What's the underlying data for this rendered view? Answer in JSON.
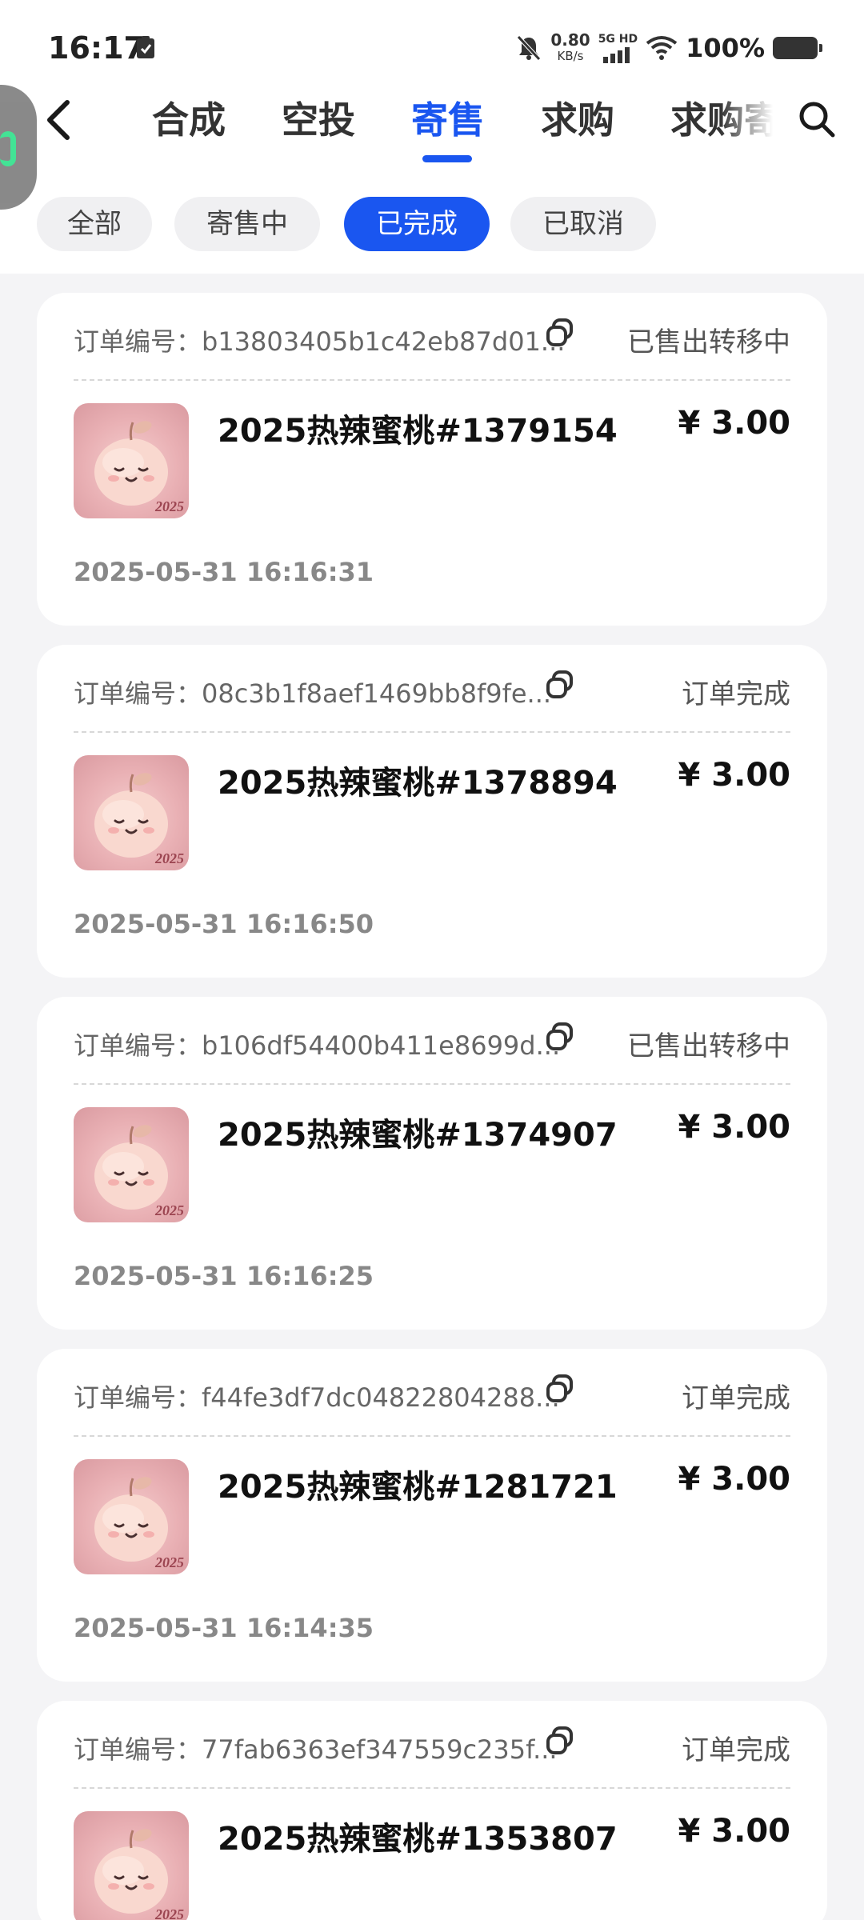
{
  "status_bar": {
    "time": "16:17",
    "net_speed_value": "0.80",
    "net_speed_unit": "KB/s",
    "network_type": "5G HD",
    "battery_percent": "100%"
  },
  "nav": {
    "tabs": [
      "合成",
      "空投",
      "寄售",
      "求购",
      "求购寄"
    ],
    "active_tab": "寄售"
  },
  "filters": {
    "chips": [
      "全部",
      "寄售中",
      "已完成",
      "已取消"
    ],
    "active_chip": "已完成"
  },
  "orders": [
    {
      "order_label": "订单编号：b13803405b1c42eb87d01...",
      "status": "已售出转移中",
      "name": "2025热辣蜜桃#1379154",
      "price": "¥ 3.00",
      "time": "2025-05-31 16:16:31"
    },
    {
      "order_label": "订单编号：08c3b1f8aef1469bb8f9fe...",
      "status": "订单完成",
      "name": "2025热辣蜜桃#1378894",
      "price": "¥ 3.00",
      "time": "2025-05-31 16:16:50"
    },
    {
      "order_label": "订单编号：b106df54400b411e8699d...",
      "status": "已售出转移中",
      "name": "2025热辣蜜桃#1374907",
      "price": "¥ 3.00",
      "time": "2025-05-31 16:16:25"
    },
    {
      "order_label": "订单编号：f44fe3df7dc04822804288...",
      "status": "订单完成",
      "name": "2025热辣蜜桃#1281721",
      "price": "¥ 3.00",
      "time": "2025-05-31 16:14:35"
    },
    {
      "order_label": "订单编号：77fab6363ef347559c235f...",
      "status": "订单完成",
      "name": "2025热辣蜜桃#1353807",
      "price": "¥ 3.00",
      "time": ""
    }
  ],
  "thumbnail_badge": "2025",
  "colors": {
    "accent": "#1a56f0",
    "background": "#f4f4f6",
    "card": "#ffffff"
  }
}
